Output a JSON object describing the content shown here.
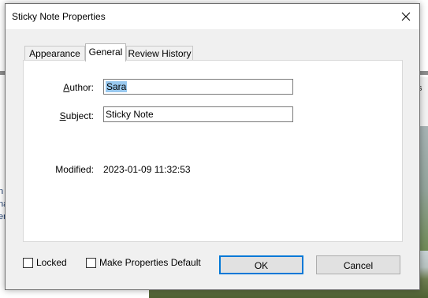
{
  "background": {
    "snippets_left": [
      "n",
      "na",
      "er"
    ],
    "snippet_right": "s"
  },
  "dialog": {
    "title": "Sticky Note Properties",
    "close_icon": "close-icon"
  },
  "tabs": [
    {
      "label": "Appearance",
      "active": false
    },
    {
      "label": "General",
      "active": true
    },
    {
      "label": "Review History",
      "active": false
    }
  ],
  "general": {
    "author_label": "Author:",
    "author_value": "Sara",
    "subject_label": "Subject:",
    "subject_value": "Sticky Note",
    "modified_label": "Modified:",
    "modified_value": "2023-01-09 11:32:53"
  },
  "footer": {
    "locked_label": "Locked",
    "locked_checked": false,
    "default_label": "Make Properties Default",
    "default_checked": false,
    "ok_label": "OK",
    "cancel_label": "Cancel"
  },
  "colors": {
    "dialog_bg": "#f0f0f0",
    "selection": "#99c9ef",
    "default_button_border": "#0078d7"
  }
}
